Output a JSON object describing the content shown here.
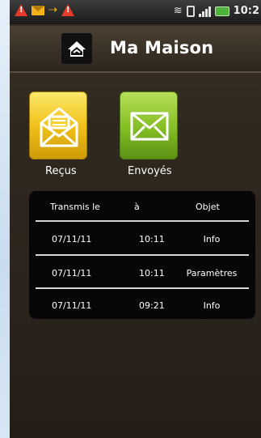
{
  "status_bar": {
    "time": "10:2",
    "left_icons": [
      "warning-icon",
      "mail-icon",
      "usb-icon",
      "warning-icon"
    ],
    "right_icons": [
      "wifi-icon",
      "phone-icon",
      "signal-icon",
      "battery-icon"
    ]
  },
  "app": {
    "title": "Ma Maison",
    "logo_icon": "house-logo-icon"
  },
  "buttons": {
    "received": {
      "label": "Reçus",
      "icon": "open-envelope-icon",
      "color": "#f0c21b"
    },
    "sent": {
      "label": "Envoyés",
      "icon": "envelope-icon",
      "color": "#84bd24"
    }
  },
  "table": {
    "headers": [
      "Transmis le",
      "à",
      "Objet"
    ],
    "rows": [
      {
        "date": "07/11/11",
        "time": "10:11",
        "subject": "Info"
      },
      {
        "date": "07/11/11",
        "time": "10:11",
        "subject": "Paramètres"
      },
      {
        "date": "07/11/11",
        "time": "09:21",
        "subject": "Info"
      }
    ]
  },
  "colors": {
    "background": "#2c251d",
    "table_bg": "#070707",
    "page_frame": "#cfe2f3"
  }
}
